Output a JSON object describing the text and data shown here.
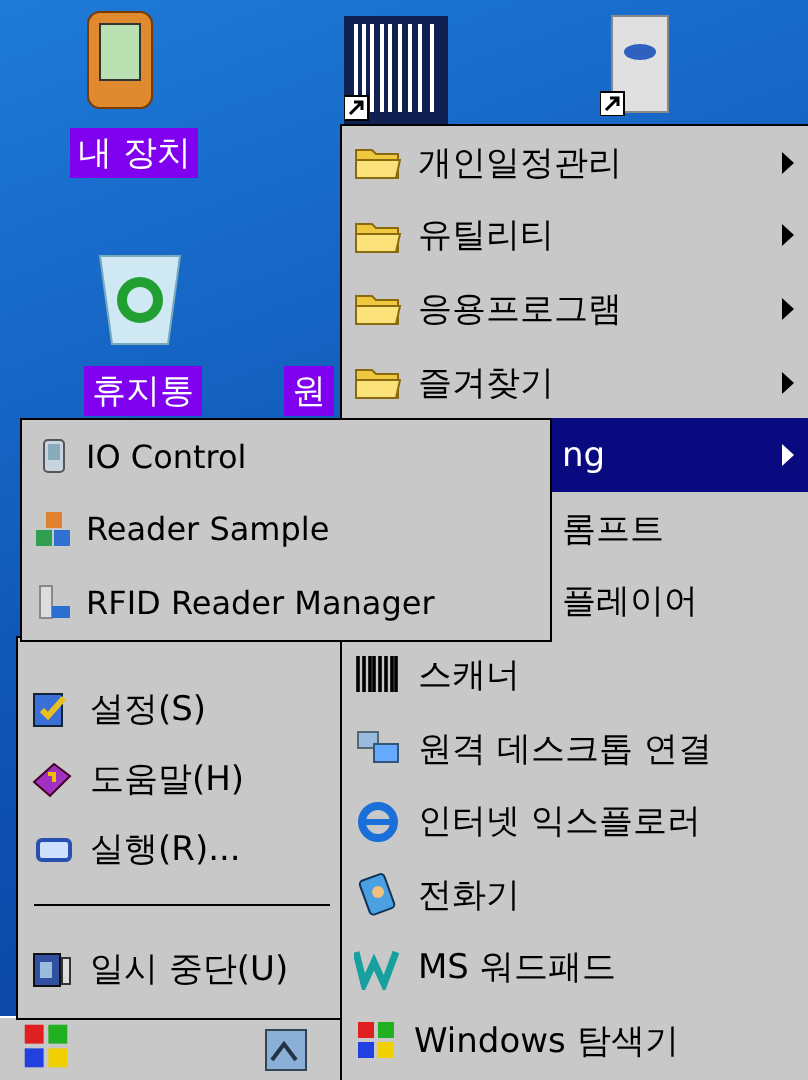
{
  "desktop_labels": [
    "내 장치",
    "휴지통",
    "원"
  ],
  "start_menu": {
    "items": [
      {
        "kind": "item",
        "label": "설정(S)"
      },
      {
        "kind": "item",
        "label": "도움말(H)"
      },
      {
        "kind": "item",
        "label": "실행(R)..."
      },
      {
        "kind": "separator"
      },
      {
        "kind": "item",
        "label": "일시 중단(U)"
      }
    ]
  },
  "programs_menu": {
    "items": [
      {
        "kind": "folder",
        "label": "개인일정관리",
        "submenu": true,
        "selected": false
      },
      {
        "kind": "folder",
        "label": "유틸리티",
        "submenu": true,
        "selected": false
      },
      {
        "kind": "folder",
        "label": "응용프로그램",
        "submenu": true,
        "selected": false
      },
      {
        "kind": "folder",
        "label": "즐겨찾기",
        "submenu": true,
        "selected": false
      },
      {
        "kind": "partial",
        "label": "ng",
        "submenu": true,
        "selected": true
      },
      {
        "kind": "partial",
        "label": "롬프트",
        "submenu": false,
        "selected": false
      },
      {
        "kind": "partial",
        "label": "플레이어",
        "submenu": false,
        "selected": false
      },
      {
        "kind": "app",
        "label": "스캐너",
        "submenu": false,
        "selected": false
      },
      {
        "kind": "app",
        "label": "원격 데스크톱 연결",
        "submenu": false,
        "selected": false
      },
      {
        "kind": "app",
        "label": "인터넷 익스플로러",
        "submenu": false,
        "selected": false
      },
      {
        "kind": "app",
        "label": "전화기",
        "submenu": false,
        "selected": false
      },
      {
        "kind": "app",
        "label": "MS 워드패드",
        "submenu": false,
        "selected": false
      },
      {
        "kind": "app",
        "label": "Windows 탐색기",
        "submenu": false,
        "selected": false
      }
    ]
  },
  "flyout_menu": {
    "items": [
      {
        "label": "IO Control",
        "selected": false
      },
      {
        "label": "Reader Sample",
        "selected": false
      },
      {
        "label": "RFID Reader Manager",
        "selected": false
      }
    ]
  }
}
